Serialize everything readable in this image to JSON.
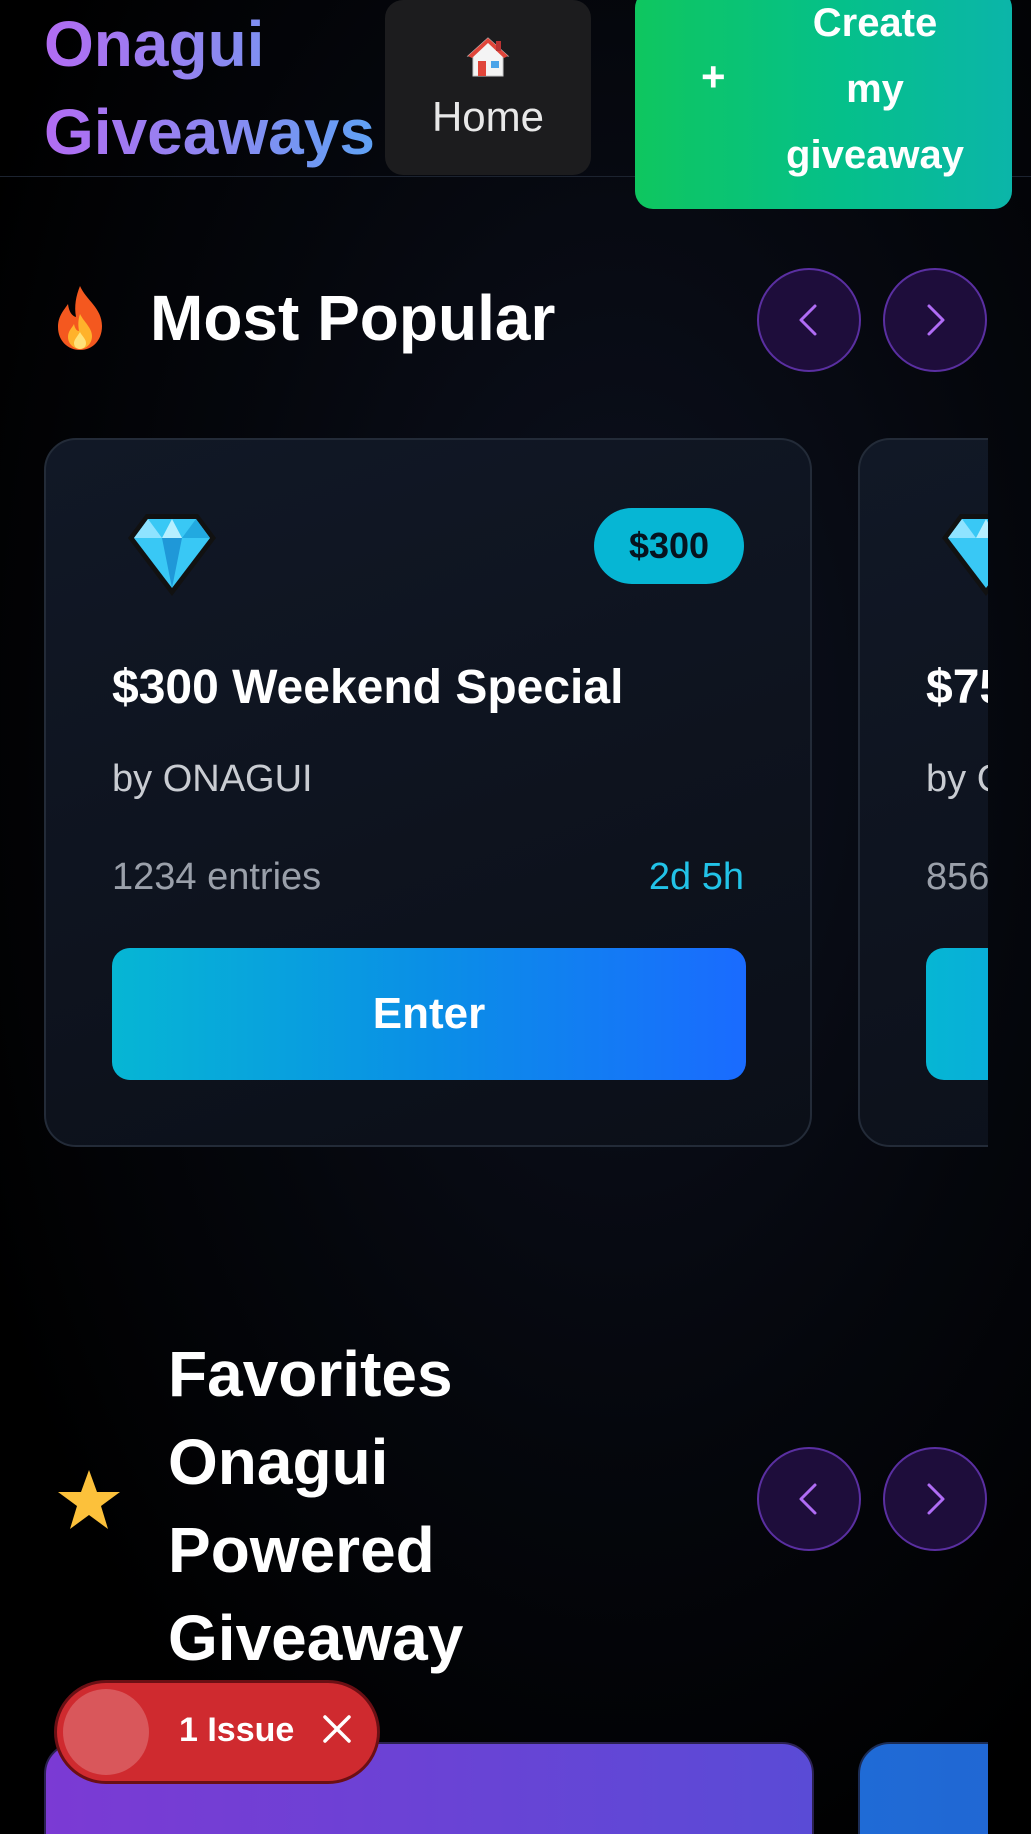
{
  "header": {
    "brand_line1": "Onagui",
    "brand_line2": "Giveaways",
    "home_label": "Home",
    "create_plus": "+",
    "create_label_line1": "Create",
    "create_label_line2": "my",
    "create_label_line3": "giveaway"
  },
  "popular": {
    "icon": "fire-icon",
    "title": "Most Popular",
    "cards": [
      {
        "icon": "gem-icon",
        "price": "$300",
        "title": "$300 Weekend Special",
        "host": "by ONAGUI",
        "entries": "1234 entries",
        "time_left": "2d 5h",
        "button": "Enter"
      },
      {
        "icon": "gem-icon",
        "title": "$75",
        "host": "by C",
        "entries": "856"
      }
    ]
  },
  "favorites": {
    "icon": "star-icon",
    "title_line1": "Favorites",
    "title_line2": "Onagui",
    "title_line3": "Powered",
    "title_line4": "Giveaway"
  },
  "issue_toast": {
    "label": "1 Issue"
  },
  "colors": {
    "accent_cyan": "#06b6d4",
    "accent_green": "#0fc65f",
    "nav_purple": "#1e0d3b",
    "issue_red": "#cf2a2f"
  }
}
